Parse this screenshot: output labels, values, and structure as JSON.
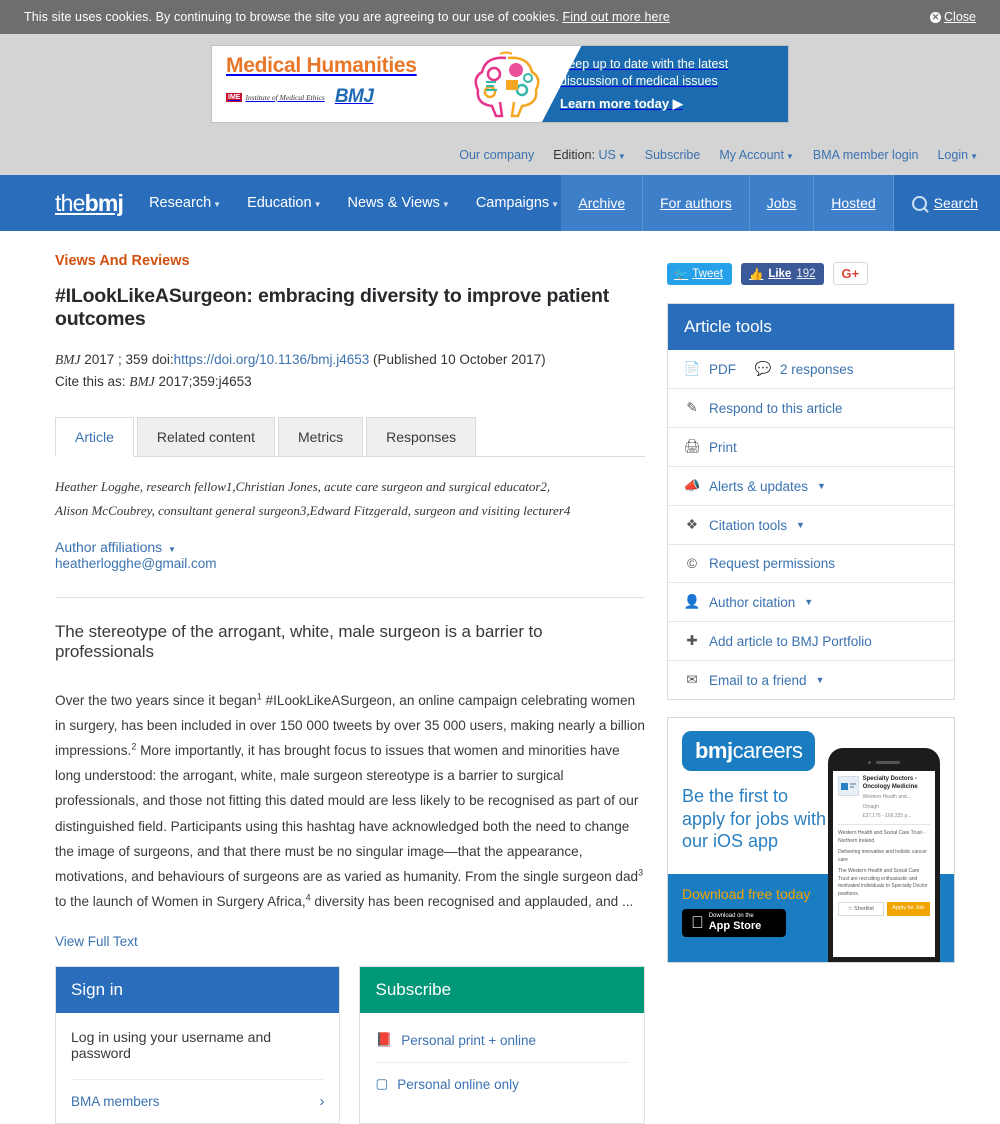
{
  "cookie": {
    "text": "This site uses cookies. By continuing to browse the site you are agreeing to our use of cookies.",
    "link": "Find out more here",
    "close": "Close"
  },
  "ad_banner": {
    "title": "Medical Humanities",
    "ime_badge": "IME",
    "ime_text": "Institute of Medical Ethics",
    "brand": "BMJ",
    "message_line1": "Keep up to date with the latest",
    "message_line2": "discussion of medical issues",
    "cta": "Learn more today"
  },
  "utility_nav": {
    "our_company": "Our company",
    "edition_label": "Edition:",
    "edition_value": "US",
    "subscribe": "Subscribe",
    "my_account": "My Account",
    "bma_login": "BMA member login",
    "login": "Login"
  },
  "main_nav": {
    "logo_the": "the",
    "logo_bmj": "bmj",
    "items": [
      {
        "label": "Research",
        "dropdown": true
      },
      {
        "label": "Education",
        "dropdown": true
      },
      {
        "label": "News & Views",
        "dropdown": true
      },
      {
        "label": "Campaigns",
        "dropdown": true
      }
    ],
    "segments": [
      "Archive",
      "For authors",
      "Jobs",
      "Hosted"
    ],
    "search": "Search"
  },
  "article": {
    "kicker": "Views And Reviews",
    "title": "#ILookLikeASurgeon: embracing diversity to improve patient outcomes",
    "journal": "BMJ",
    "year_volume": "2017 ; 359",
    "doi_label": "doi:",
    "doi_url": "https://doi.org/10.1136/bmj.j4653",
    "published": "(Published 10 October 2017)",
    "cite_prefix": "Cite this as:",
    "cite_journal": "BMJ",
    "cite_value": "2017;359:j4653",
    "tabs": [
      {
        "label": "Article",
        "active": true
      },
      {
        "label": "Related content",
        "active": false
      },
      {
        "label": "Metrics",
        "active": false
      },
      {
        "label": "Responses",
        "active": false
      }
    ],
    "authors_line1": "Heather Logghe, research fellow1,Christian Jones, acute care surgeon and surgical educator2,",
    "authors_line2": "Alison McCoubrey, consultant general surgeon3,Edward Fitzgerald, surgeon and visiting lecturer4",
    "author_affiliations": "Author affiliations",
    "email": "heatherlogghe@gmail.com",
    "standfirst": "The stereotype of the arrogant, white, male surgeon is a barrier to professionals",
    "body_parts": {
      "p1a": "Over the two years since it began",
      "sup1": "1",
      "p1b": "  #ILookLikeASurgeon, an online campaign celebrating women in surgery, has been included in over 150 000 tweets by over 35 000 users, making nearly a billion impressions.",
      "sup2": "2",
      "p1c": "  More importantly, it has brought focus to issues that women and minorities have long understood: the arrogant, white, male surgeon stereotype is a barrier to surgical professionals, and those not fitting this dated mould are less likely to be recognised as part of our distinguished field. Participants using this hashtag have acknowledged both the need to change the image of surgeons, and that there must be no singular image—that the appearance, motivations, and behaviours of surgeons are as varied as humanity. From the single surgeon dad",
      "sup3": "3",
      "p1d": "  to the launch of Women in Surgery Africa,",
      "sup4": "4",
      "p1e": "  diversity has been recognised and applauded, and ..."
    },
    "view_full_text": "View Full Text"
  },
  "signin_box": {
    "heading": "Sign in",
    "subtext": "Log in using your username and password",
    "rows": [
      "BMA members"
    ]
  },
  "subscribe_box": {
    "heading": "Subscribe",
    "rows": [
      "Personal print + online",
      "Personal online only"
    ]
  },
  "social": {
    "tweet": "Tweet",
    "like": "Like",
    "like_count": "192",
    "gplus": "G+"
  },
  "article_tools": {
    "heading": "Article tools",
    "pdf": "PDF",
    "responses": "2 responses",
    "items": [
      {
        "label": "Respond to this article",
        "icon": "edit-icon",
        "dropdown": false
      },
      {
        "label": "Print",
        "icon": "printer-icon",
        "dropdown": false
      },
      {
        "label": "Alerts & updates",
        "icon": "megaphone-icon",
        "dropdown": true
      },
      {
        "label": "Citation tools",
        "icon": "citation-icon",
        "dropdown": true
      },
      {
        "label": "Request permissions",
        "icon": "copyright-icon",
        "dropdown": false
      },
      {
        "label": "Author citation",
        "icon": "person-icon",
        "dropdown": true
      },
      {
        "label": "Add article to BMJ Portfolio",
        "icon": "plus-circle-icon",
        "dropdown": false
      },
      {
        "label": "Email to a friend",
        "icon": "envelope-icon",
        "dropdown": true
      }
    ]
  },
  "careers_ad": {
    "logo_bold": "bmj",
    "logo_rest": "careers",
    "message": "Be the first to apply for jobs with our iOS app",
    "download": "Download free today",
    "appstore_small": "Download on the",
    "appstore_big": "App Store",
    "job": {
      "title": "Specialty Doctors - Oncology Medicine",
      "employer_short": "Western Health and...",
      "location": "Omagh",
      "salary": "£37,176 - £69,325 p...",
      "trust": "Western Health and Social Care Trust - Northern Ireland",
      "tagline": "Delivering innovative and holistic cancer care",
      "description": "The Western Health and Social Care Trust are recruiting enthusiastic and motivated individuals to Specialty Doctor positions.",
      "shortlist": "Shortlist",
      "apply": "Apply for Job"
    }
  },
  "colors": {
    "nav_blue": "#2a6ebb",
    "nav_blue_light": "#3d7fc8",
    "kicker_orange": "#d2500f",
    "link_blue": "#3b72b0",
    "subscribe_green": "#009878",
    "cookie_grey": "#6e6e6e"
  }
}
